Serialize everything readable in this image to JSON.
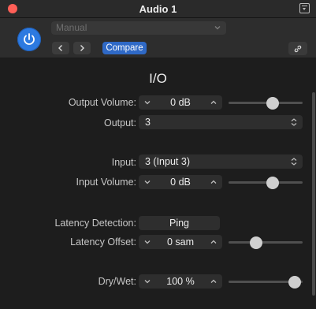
{
  "window": {
    "title": "Audio 1"
  },
  "header": {
    "preset": "Manual",
    "compare_label": "Compare"
  },
  "main": {
    "section_title": "I/O",
    "output_volume": {
      "label": "Output Volume:",
      "value": "0 dB",
      "slider_level": 0.62
    },
    "output": {
      "label": "Output:",
      "value": "3"
    },
    "input": {
      "label": "Input:",
      "value": "3 (Input 3)"
    },
    "input_volume": {
      "label": "Input Volume:",
      "value": "0 dB",
      "slider_level": 0.62
    },
    "latency_detection": {
      "label": "Latency Detection:",
      "button": "Ping"
    },
    "latency_offset": {
      "label": "Latency Offset:",
      "value": "0 sam",
      "slider_level": 0.34
    },
    "dry_wet": {
      "label": "Dry/Wet:",
      "value": "100 %",
      "slider_level": 0.98
    }
  },
  "colors": {
    "accent": "#2d7ae0",
    "close": "#ff5f57",
    "background": "#1d1d1d"
  },
  "icons": [
    "close-icon",
    "expand-icon",
    "power-icon",
    "chevron-down-icon",
    "chevron-left-icon",
    "chevron-right-icon",
    "link-icon",
    "chevron-up-icon",
    "select-updown-icon"
  ]
}
